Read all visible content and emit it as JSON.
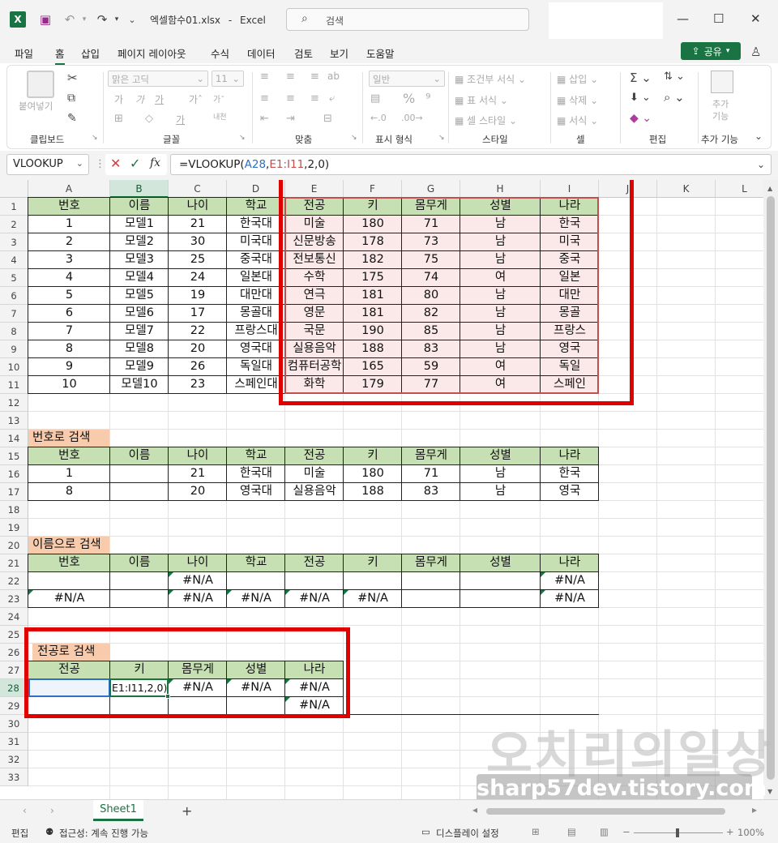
{
  "titlebar": {
    "filename": "엑셀함수01.xlsx",
    "separator": "-",
    "app": "Excel",
    "search_placeholder": "검색"
  },
  "menu": [
    "파일",
    "홈",
    "삽입",
    "페이지 레이아웃",
    "수식",
    "데이터",
    "검토",
    "보기",
    "도움말"
  ],
  "share_label": "공유",
  "ribbon": {
    "paste": "붙여넣기",
    "clipboard": "클립보드",
    "font": "글꼴",
    "font_name": "맑은 고딕",
    "font_size": "11",
    "align": "맞춤",
    "number": "표시 형식",
    "number_format": "일반",
    "cond_format": "조건부 서식",
    "table_format": "표 서식",
    "cell_style": "셀 스타일",
    "style": "스타일",
    "insert": "삽입",
    "delete": "삭제",
    "format": "서식",
    "cells": "셀",
    "edit": "편집",
    "addins_top": "추가",
    "addins_bottom": "기능",
    "addins": "추가 기능"
  },
  "formula": {
    "name_box": "VLOOKUP",
    "eq": "=VLOOKUP(",
    "ref1": "A28",
    "comma": ",",
    "ref2": "E1:I11",
    "rest": ",2,0)"
  },
  "columns": [
    "A",
    "B",
    "C",
    "D",
    "E",
    "F",
    "G",
    "H",
    "I",
    "J",
    "K",
    "L"
  ],
  "rows": [
    "1",
    "2",
    "3",
    "4",
    "5",
    "6",
    "7",
    "8",
    "9",
    "10",
    "11",
    "12",
    "13",
    "14",
    "15",
    "16",
    "17",
    "18",
    "19",
    "20",
    "21",
    "22",
    "23",
    "24",
    "25",
    "26",
    "27",
    "28",
    "29",
    "30",
    "31",
    "32",
    "33"
  ],
  "table_header": [
    "번호",
    "이름",
    "나이",
    "학교",
    "전공",
    "키",
    "몸무게",
    "성별",
    "나라"
  ],
  "table_rows": [
    [
      "1",
      "모델1",
      "21",
      "한국대",
      "미술",
      "180",
      "71",
      "남",
      "한국"
    ],
    [
      "2",
      "모델2",
      "30",
      "미국대",
      "신문방송",
      "178",
      "73",
      "남",
      "미국"
    ],
    [
      "3",
      "모델3",
      "25",
      "중국대",
      "전보통신",
      "182",
      "75",
      "남",
      "중국"
    ],
    [
      "4",
      "모델4",
      "24",
      "일본대",
      "수학",
      "175",
      "74",
      "여",
      "일본"
    ],
    [
      "5",
      "모델5",
      "19",
      "대만대",
      "연극",
      "181",
      "80",
      "남",
      "대만"
    ],
    [
      "6",
      "모델6",
      "17",
      "몽골대",
      "영문",
      "181",
      "82",
      "남",
      "몽골"
    ],
    [
      "7",
      "모델7",
      "22",
      "프랑스대",
      "국문",
      "190",
      "85",
      "남",
      "프랑스"
    ],
    [
      "8",
      "모델8",
      "20",
      "영국대",
      "실용음악",
      "188",
      "83",
      "남",
      "영국"
    ],
    [
      "9",
      "모델9",
      "26",
      "독일대",
      "컴퓨터공학",
      "165",
      "59",
      "여",
      "독일"
    ],
    [
      "10",
      "모델10",
      "23",
      "스페인대",
      "화학",
      "179",
      "77",
      "여",
      "스페인"
    ]
  ],
  "search_by_number": {
    "title": "번호로 검색",
    "rows": [
      [
        "1",
        "",
        "21",
        "한국대",
        "미술",
        "180",
        "71",
        "남",
        "한국"
      ],
      [
        "8",
        "",
        "20",
        "영국대",
        "실용음악",
        "188",
        "83",
        "남",
        "영국"
      ]
    ]
  },
  "search_by_name": {
    "title": "이름으로 검색",
    "rows": [
      [
        "",
        "",
        "#N/A",
        "",
        "",
        "",
        "",
        "",
        "#N/A"
      ],
      [
        "#N/A",
        "",
        "#N/A",
        "#N/A",
        "#N/A",
        "#N/A",
        "",
        "",
        "#N/A"
      ]
    ]
  },
  "search_by_major": {
    "title": "전공로 검색",
    "header": [
      "전공",
      "키",
      "몸무게",
      "성별",
      "나라"
    ],
    "rows": [
      [
        "",
        "E1:I11,2,0)",
        "#N/A",
        "#N/A",
        "#N/A"
      ],
      [
        "",
        "",
        "",
        "",
        "#N/A"
      ]
    ]
  },
  "sheet_tab": "Sheet1",
  "status": {
    "mode": "편집",
    "accessibility": "접근성: 계속 진행 가능",
    "display": "디스플레이 설정",
    "zoom": "100%"
  },
  "watermark": {
    "line1": "오치리의일상",
    "line2": "sharp57dev.tistory.com"
  },
  "colors": {
    "green_header": "#c6e0b4",
    "pink": "#fbe8e8",
    "orange": "#f8cbad",
    "red_box": "#e00000",
    "excel_green": "#1a7343"
  }
}
